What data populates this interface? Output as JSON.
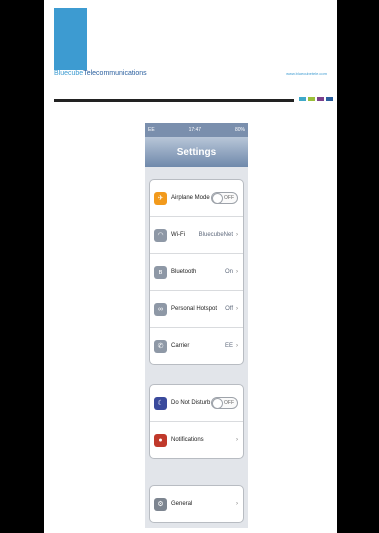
{
  "slide": {
    "logo_part1": "Bluecube",
    "logo_part2": "Telecommunications",
    "site_url": "www.bluecubetele.com",
    "accent_colors": [
      "#3fa9c9",
      "#9bbf3b",
      "#7b3f8c",
      "#2a5f9e"
    ]
  },
  "phone": {
    "status": {
      "carrier": "EE",
      "time": "17:47",
      "battery": "80%"
    },
    "nav_title": "Settings",
    "groups": [
      [
        {
          "label": "Airplane Mode",
          "toggle": "OFF",
          "icon": "airplane-icon",
          "color": "#f29a1c",
          "glyph": "✈"
        },
        {
          "label": "Wi-Fi",
          "value": "BluecubeNet",
          "icon": "wifi-icon",
          "color": "#8e98a6",
          "glyph": "◠"
        },
        {
          "label": "Bluetooth",
          "value": "On",
          "icon": "bluetooth-icon",
          "color": "#8e98a6",
          "glyph": "ʙ"
        },
        {
          "label": "Personal Hotspot",
          "value": "Off",
          "icon": "hotspot-icon",
          "color": "#8e98a6",
          "glyph": "∞"
        },
        {
          "label": "Carrier",
          "value": "EE",
          "icon": "carrier-icon",
          "color": "#8e98a6",
          "glyph": "✆"
        }
      ],
      [
        {
          "label": "Do Not Disturb",
          "toggle": "OFF",
          "icon": "moon-icon",
          "color": "#3a4a9c",
          "glyph": "☾"
        },
        {
          "label": "Notifications",
          "value": "",
          "icon": "notifications-icon",
          "color": "#c0392b",
          "glyph": "●"
        }
      ],
      [
        {
          "label": "General",
          "value": "",
          "icon": "gear-icon",
          "color": "#7d8590",
          "glyph": "⚙"
        }
      ]
    ]
  }
}
